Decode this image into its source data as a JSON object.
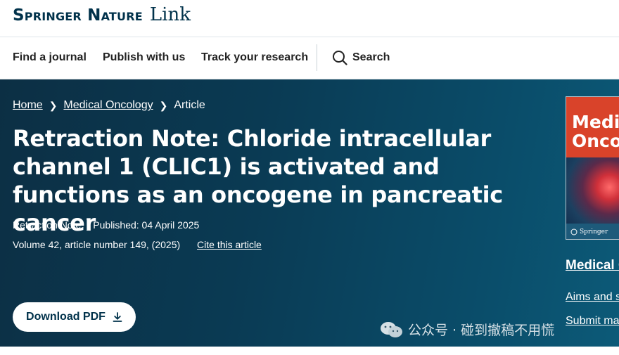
{
  "brand": {
    "main": "Springer Nature",
    "sub": "Link"
  },
  "nav": {
    "find_journal": "Find a journal",
    "publish": "Publish with us",
    "track": "Track your research",
    "search_label": "Search"
  },
  "breadcrumb": {
    "home": "Home",
    "journal": "Medical Oncology",
    "current": "Article"
  },
  "article": {
    "title": "Retraction Note: Chloride intracellular channel 1 (CLIC1) is activated and functions as an oncogene in pancreatic cancer",
    "type": "Retraction Note",
    "published": "Published: 04 April 2025",
    "volume": "Volume 42, article number 149, (2025)",
    "cite_label": "Cite this article"
  },
  "download": {
    "label": "Download PDF"
  },
  "sidebar": {
    "cover_title": "Medical\nOncology",
    "cover_publisher": "Springer",
    "journal_link": "Medical Oncology",
    "aims_link": "Aims and scope",
    "submit_link": "Submit manuscript"
  },
  "watermark": {
    "text": "公众号 · 碰到撤稿不用慌"
  },
  "colors": {
    "brand_navy": "#01324b",
    "hero_bg": "#0a3a53",
    "cover_red": "#d9432a"
  }
}
